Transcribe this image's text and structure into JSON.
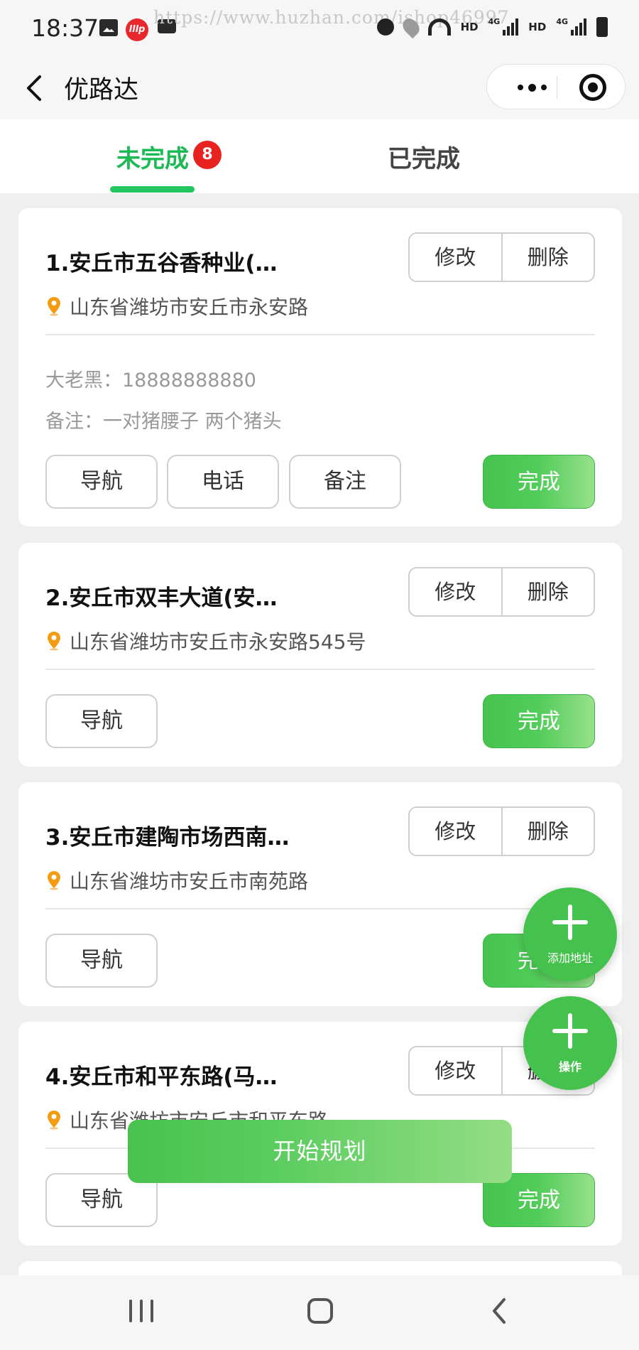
{
  "status_bar": {
    "time": "18:37",
    "brand_badge": "lllp",
    "net1": "HD",
    "net1_sig": "4G",
    "net2": "HD",
    "net2_sig": "4G",
    "watermark": "https://www.huzhan.com/ishop46997",
    "icons": [
      "gallery-icon",
      "brand-app-icon",
      "chat-icon",
      "alarm-icon",
      "location-icon",
      "wifi-icon",
      "signal-icon",
      "battery-icon"
    ]
  },
  "nav": {
    "title": "优路达",
    "icons": [
      "back-icon",
      "more-icon",
      "close-mini-program-icon"
    ]
  },
  "tabs": {
    "active_label": "未完成",
    "active_count": "8",
    "done_label": "已完成",
    "accent_color": "#22c55e",
    "badge_color": "#e8231f"
  },
  "cards": [
    {
      "title": "1.安丘市五谷香种业(…",
      "address": "山东省潍坊市安丘市永安路",
      "contact": "大老黑：18888888880",
      "note": "备注：一对猪腰子 两个猪头",
      "edit": "修改",
      "delete": "删除",
      "nav": "导航",
      "phone": "电话",
      "remark": "备注",
      "done": "完成"
    },
    {
      "title": "2.安丘市双丰大道(安…",
      "address": "山东省潍坊市安丘市永安路545号",
      "edit": "修改",
      "delete": "删除",
      "nav": "导航",
      "done": "完成"
    },
    {
      "title": "3.安丘市建陶市场西南…",
      "address": "山东省潍坊市安丘市南苑路",
      "edit": "修改",
      "delete": "删除",
      "nav": "导航",
      "done": "完成"
    },
    {
      "title": "4.安丘市和平东路(马…",
      "address": "山东省潍坊市安丘市和平东路",
      "edit": "修改",
      "delete": "删除",
      "nav": "导航",
      "done": "完成"
    }
  ],
  "fab_add": {
    "label": "添加地址",
    "icon": "plus-icon"
  },
  "fab_ops": {
    "label": "操作",
    "icon": "plus-icon"
  },
  "start_button": "开始规划",
  "primary_green": "#45c24d",
  "system_nav": {
    "icons": [
      "recent-apps-icon",
      "home-icon",
      "system-back-icon"
    ]
  }
}
